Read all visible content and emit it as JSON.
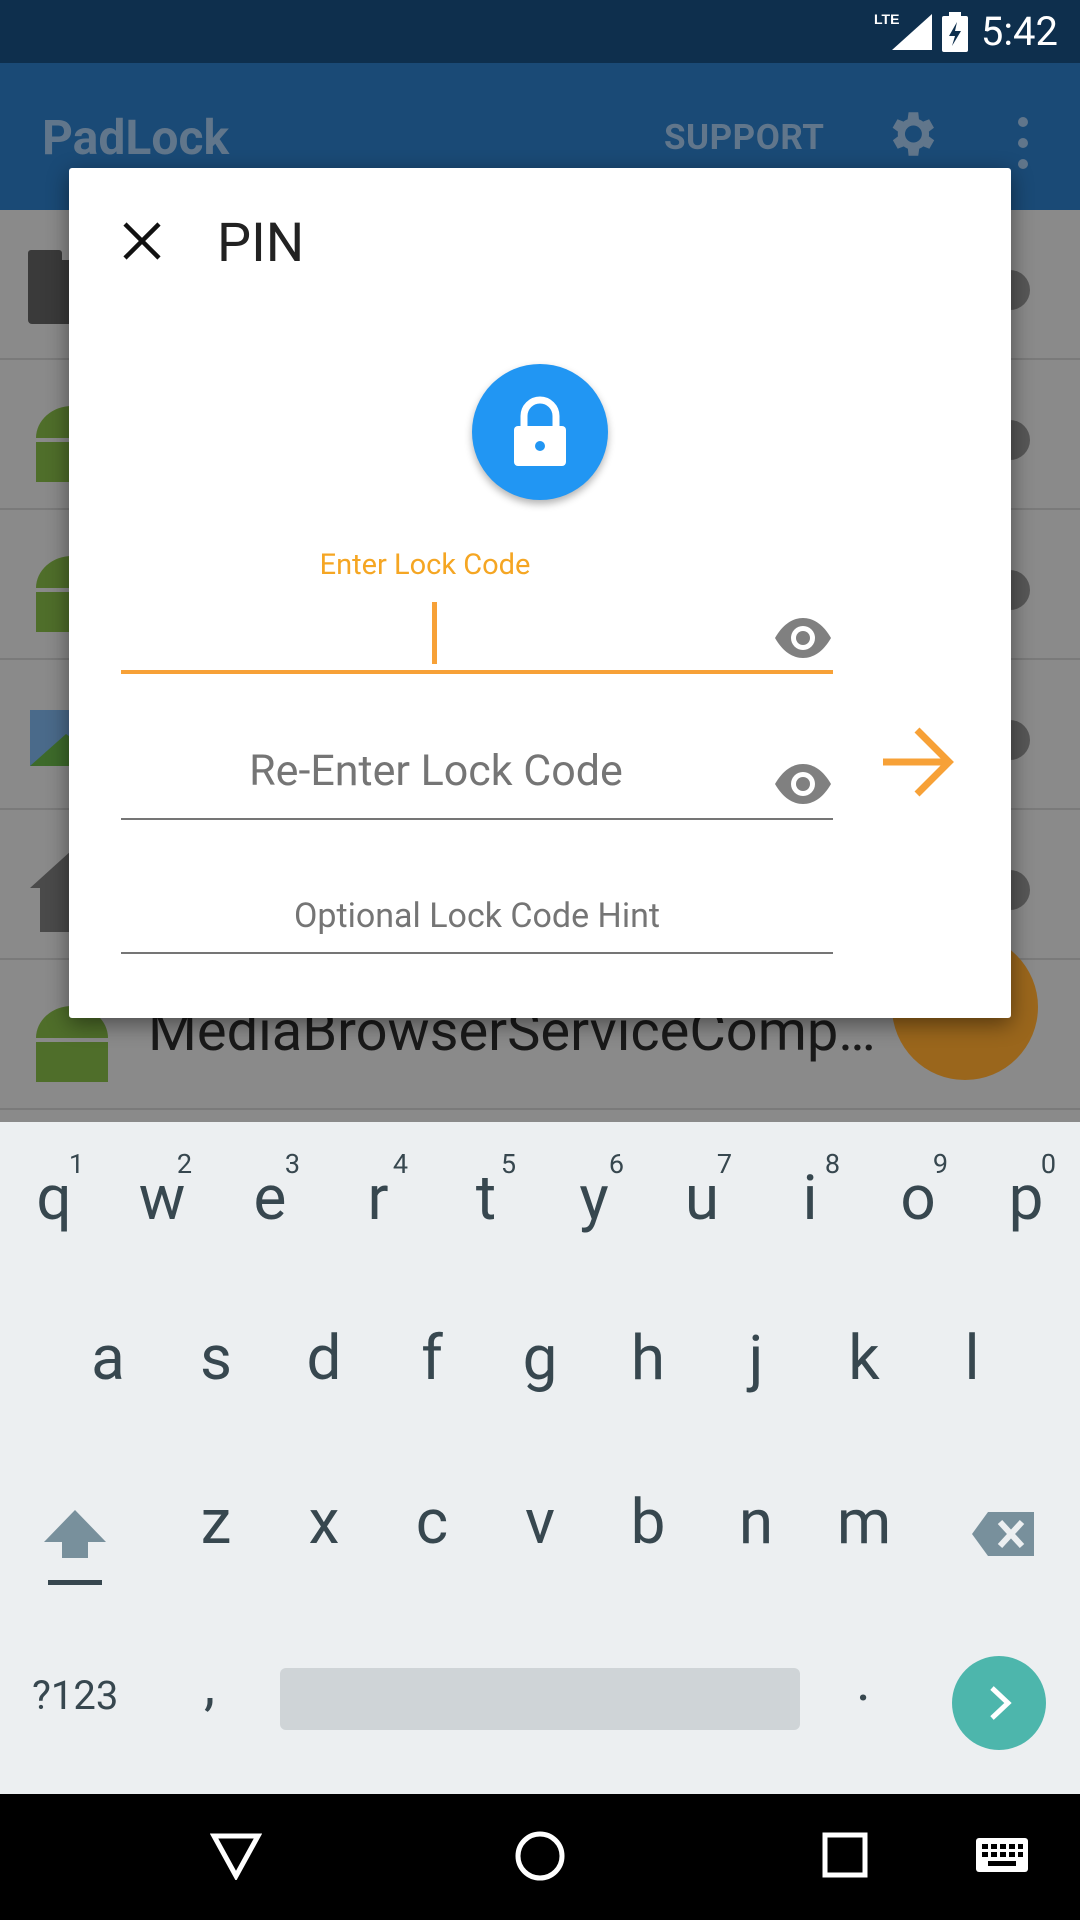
{
  "status_bar": {
    "time": "5:42",
    "network": "LTE"
  },
  "app_bar": {
    "title": "PadLock",
    "support_label": "SUPPORT"
  },
  "background_list": {
    "partial_item_name": "MediaBrowserServiceComp…"
  },
  "dialog": {
    "title": "PIN",
    "enter_label": "Enter Lock Code",
    "reenter_placeholder": "Re-Enter Lock Code",
    "hint_placeholder": "Optional Lock Code Hint"
  },
  "keyboard": {
    "row1": [
      {
        "key": "q",
        "alt": "1"
      },
      {
        "key": "w",
        "alt": "2"
      },
      {
        "key": "e",
        "alt": "3"
      },
      {
        "key": "r",
        "alt": "4"
      },
      {
        "key": "t",
        "alt": "5"
      },
      {
        "key": "y",
        "alt": "6"
      },
      {
        "key": "u",
        "alt": "7"
      },
      {
        "key": "i",
        "alt": "8"
      },
      {
        "key": "o",
        "alt": "9"
      },
      {
        "key": "p",
        "alt": "0"
      }
    ],
    "row2": [
      "a",
      "s",
      "d",
      "f",
      "g",
      "h",
      "j",
      "k",
      "l"
    ],
    "row3": [
      "z",
      "x",
      "c",
      "v",
      "b",
      "n",
      "m"
    ],
    "symbols_label": "?123",
    "comma": ",",
    "period": "."
  },
  "colors": {
    "accent": "#f7a137",
    "primary": "#2196f3",
    "go_button": "#4db6ac"
  }
}
